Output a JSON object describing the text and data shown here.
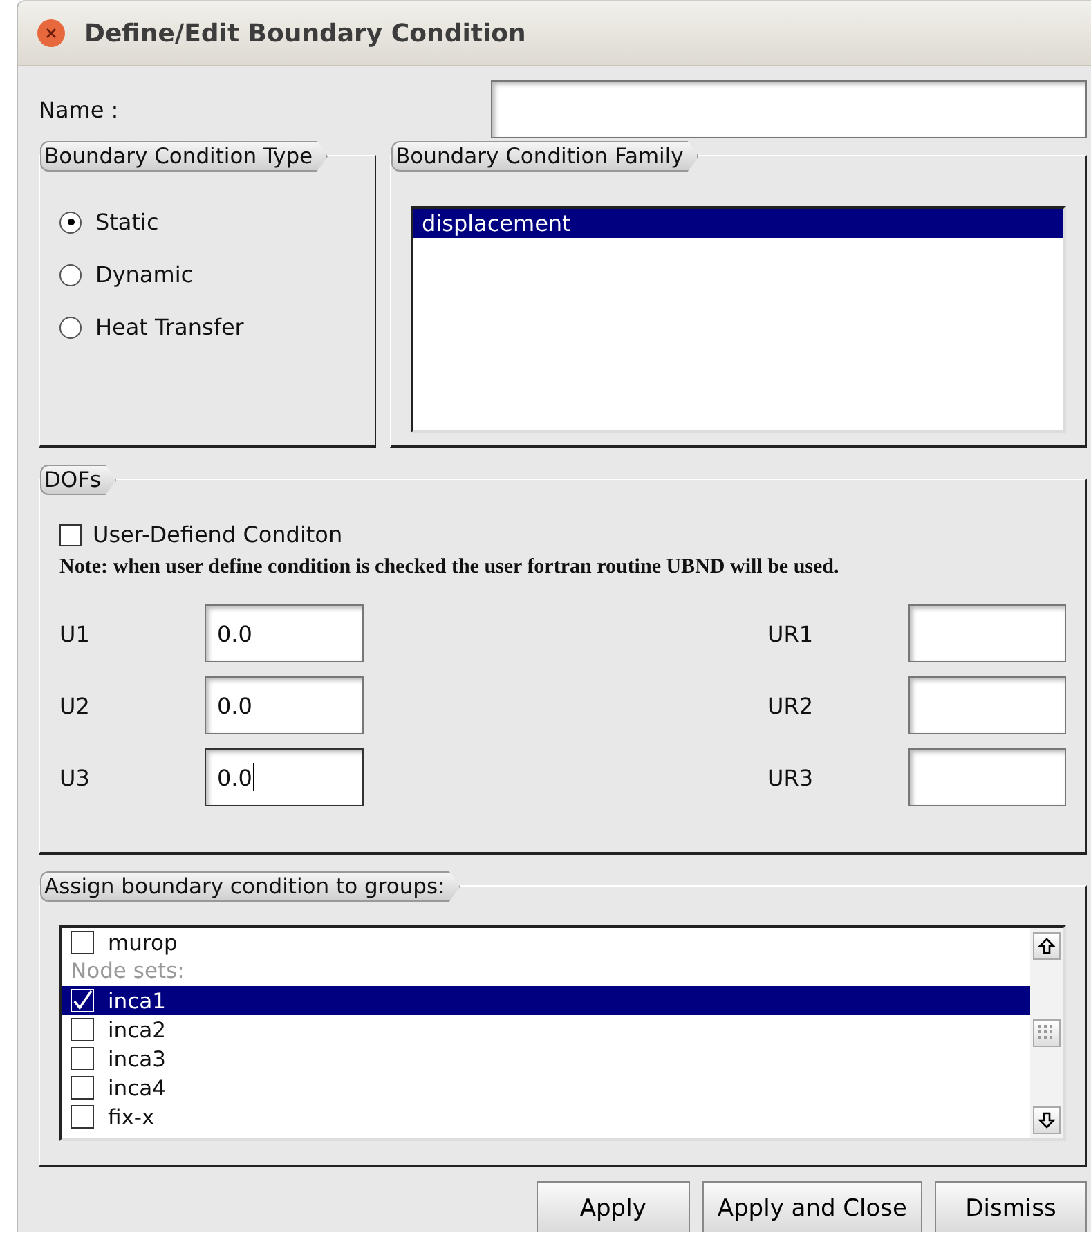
{
  "window": {
    "title": "Define/Edit Boundary Condition"
  },
  "name": {
    "label": "Name :"
  },
  "type_group": {
    "title": "Boundary Condition Type",
    "options": [
      {
        "label": "Static",
        "selected": true
      },
      {
        "label": "Dynamic",
        "selected": false
      },
      {
        "label": "Heat Transfer",
        "selected": false
      }
    ]
  },
  "family_group": {
    "title": "Boundary Condition Family",
    "items": [
      {
        "label": "displacement",
        "selected": true
      }
    ]
  },
  "dofs": {
    "title": "DOFs",
    "user_defined": {
      "label": "User-Defiend Conditon",
      "checked": false
    },
    "note": "Note: when user define condition is checked the user fortran routine UBND will be used.",
    "fields": [
      {
        "label": "U1",
        "value": "0.0",
        "focused": false
      },
      {
        "label": "UR1",
        "focused": false
      },
      {
        "label": "U2",
        "value": "0.0",
        "focused": false
      },
      {
        "label": "UR2",
        "focused": false
      },
      {
        "label": "U3",
        "value": "0.0",
        "focused": true
      },
      {
        "label": "UR3",
        "focused": false
      }
    ]
  },
  "groups": {
    "title": "Assign boundary condition to groups:",
    "items": [
      {
        "kind": "item",
        "label": "murop",
        "checked": false,
        "selected": false
      },
      {
        "kind": "header",
        "label": "Node sets:"
      },
      {
        "kind": "item",
        "label": "inca1",
        "checked": true,
        "selected": true
      },
      {
        "kind": "item",
        "label": "inca2",
        "checked": false,
        "selected": false
      },
      {
        "kind": "item",
        "label": "inca3",
        "checked": false,
        "selected": false
      },
      {
        "kind": "item",
        "label": "inca4",
        "checked": false,
        "selected": false
      },
      {
        "kind": "item",
        "label": "fix-x",
        "checked": false,
        "selected": false
      }
    ]
  },
  "buttons": [
    "Apply",
    "Apply and Close",
    "Dismiss"
  ]
}
